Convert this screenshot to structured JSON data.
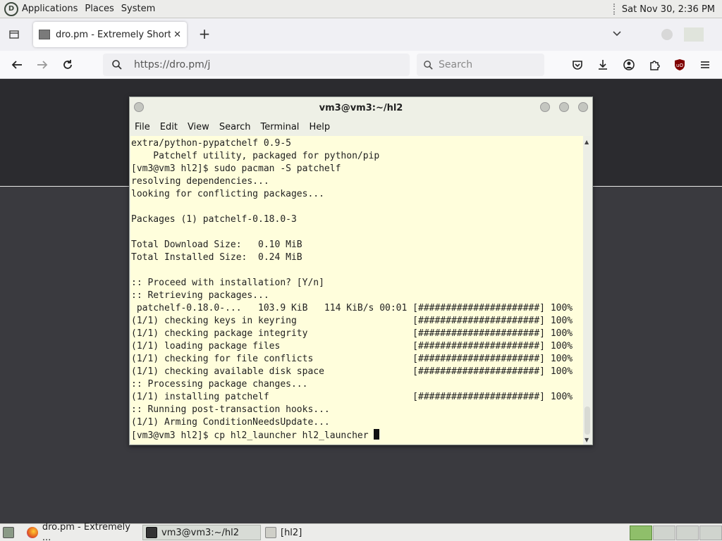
{
  "top_panel": {
    "menus": [
      "Applications",
      "Places",
      "System"
    ],
    "clock": "Sat Nov 30,  2:36 PM"
  },
  "browser": {
    "tab": {
      "title": "dro.pm - Extremely Short Li",
      "close": "✕"
    },
    "new_tab": "+",
    "url": "https://dro.pm/j",
    "search_placeholder": "Search"
  },
  "terminal": {
    "title": "vm3@vm3:~/hl2",
    "menu": [
      "File",
      "Edit",
      "View",
      "Search",
      "Terminal",
      "Help"
    ],
    "lines": [
      "extra/python-pypatchelf 0.9-5",
      "    Patchelf utility, packaged for python/pip",
      "[vm3@vm3 hl2]$ sudo pacman -S patchelf",
      "resolving dependencies...",
      "looking for conflicting packages...",
      "",
      "Packages (1) patchelf-0.18.0-3",
      "",
      "Total Download Size:   0.10 MiB",
      "Total Installed Size:  0.24 MiB",
      "",
      ":: Proceed with installation? [Y/n]",
      ":: Retrieving packages...",
      " patchelf-0.18.0-...   103.9 KiB   114 KiB/s 00:01 [######################] 100%",
      "(1/1) checking keys in keyring                     [######################] 100%",
      "(1/1) checking package integrity                   [######################] 100%",
      "(1/1) loading package files                        [######################] 100%",
      "(1/1) checking for file conflicts                  [######################] 100%",
      "(1/1) checking available disk space                [######################] 100%",
      ":: Processing package changes...",
      "(1/1) installing patchelf                          [######################] 100%",
      ":: Running post-transaction hooks...",
      "(1/1) Arming ConditionNeedsUpdate..."
    ],
    "prompt": "[vm3@vm3 hl2]$ cp hl2_launcher hl2_launcher "
  },
  "taskbar": {
    "items": [
      "dro.pm - Extremely ...",
      "vm3@vm3:~/hl2",
      "[hl2]"
    ]
  },
  "colors": {
    "terminal_bg": "#fffedc",
    "panel_bg": "#ececea",
    "page_bg": "#2b2b2f"
  }
}
